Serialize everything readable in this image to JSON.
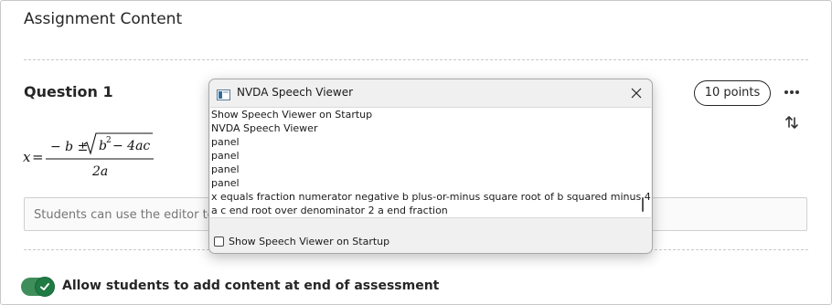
{
  "page": {
    "section_title": "Assignment Content"
  },
  "question": {
    "title": "Question 1",
    "points_label": "10 points",
    "more_icon": "more-horizontal-icon",
    "reorder_icon": "sort-arrows-icon",
    "formula": {
      "lhs": "x",
      "equals": "=",
      "numerator_prefix": "− b ±",
      "radicand_b": "b",
      "radicand_exp": "2",
      "radicand_rest": "− 4ac",
      "denominator": "2a"
    },
    "editor_placeholder": "Students can use the editor to format their responses"
  },
  "toggle": {
    "checked": true,
    "label": "Allow students to add content at end of assessment",
    "color": "#1f7a43"
  },
  "nvda": {
    "title": "NVDA Speech Viewer",
    "lines": [
      "Show Speech Viewer on Startup",
      "NVDA Speech Viewer",
      "panel",
      "panel",
      "panel",
      "panel",
      "x equals fraction numerator negative b plus-or-minus square root of b squared minus 4",
      "a c end root over denominator 2 a end fraction"
    ],
    "checkbox_label": "Show Speech Viewer on Startup",
    "checkbox_checked": false
  }
}
